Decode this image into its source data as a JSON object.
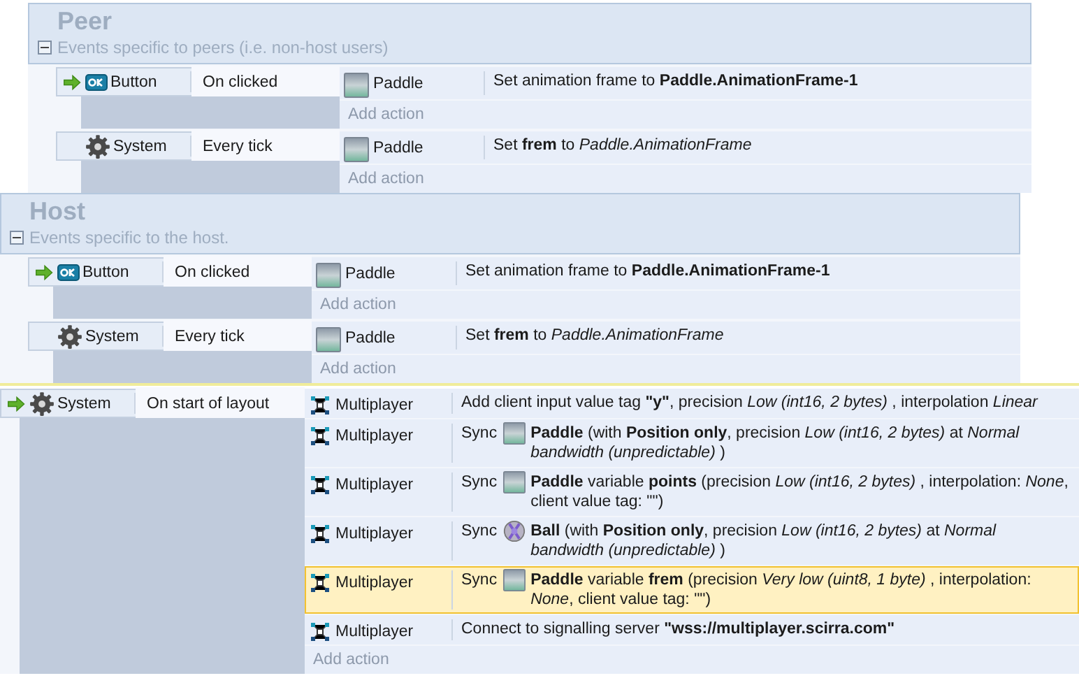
{
  "groups": [
    {
      "title": "Peer",
      "description": "Events specific to peers (i.e. non-host users)",
      "expanded": true,
      "events": [
        {
          "trigger": true,
          "conditions": [
            {
              "kind": "button",
              "object": "Button",
              "text": "On clicked"
            }
          ],
          "actions": [
            {
              "kind": "sprite",
              "object": "Paddle",
              "text": "Set animation frame to **Paddle.AnimationFrame-1**",
              "selected": false
            }
          ],
          "add_action": "Add action"
        },
        {
          "trigger": false,
          "conditions": [
            {
              "kind": "system",
              "object": "System",
              "text": "Every tick"
            }
          ],
          "actions": [
            {
              "kind": "sprite",
              "object": "Paddle",
              "text": "Set **frem** to *Paddle.AnimationFrame*",
              "selected": false
            }
          ],
          "add_action": "Add action"
        }
      ]
    },
    {
      "title": "Host",
      "description": "Events specific to the host.",
      "expanded": true,
      "events": [
        {
          "trigger": true,
          "conditions": [
            {
              "kind": "button",
              "object": "Button",
              "text": "On clicked"
            }
          ],
          "actions": [
            {
              "kind": "sprite",
              "object": "Paddle",
              "text": "Set animation frame to **Paddle.AnimationFrame-1**",
              "selected": false
            }
          ],
          "add_action": "Add action"
        },
        {
          "trigger": false,
          "conditions": [
            {
              "kind": "system",
              "object": "System",
              "text": "Every tick"
            }
          ],
          "actions": [
            {
              "kind": "sprite",
              "object": "Paddle",
              "text": "Set **frem** to *Paddle.AnimationFrame*",
              "selected": false
            }
          ],
          "add_action": "Add action"
        }
      ]
    }
  ],
  "events": [
    {
      "trigger": true,
      "conditions": [
        {
          "kind": "system",
          "object": "System",
          "text": "On start of layout"
        }
      ],
      "actions": [
        {
          "kind": "multiplayer",
          "object": "Multiplayer",
          "text": "Add client input value tag **\"y\"**, precision *Low (int16, 2 bytes)* , interpolation *Linear*",
          "selected": false
        },
        {
          "kind": "multiplayer",
          "object": "Multiplayer",
          "lead": "Sync",
          "target": {
            "kind": "sprite"
          },
          "text": "**Paddle** (with **Position only**, precision *Low (int16, 2 bytes)*  at *Normal bandwidth (unpredictable)* )",
          "selected": false
        },
        {
          "kind": "multiplayer",
          "object": "Multiplayer",
          "lead": "Sync",
          "target": {
            "kind": "sprite"
          },
          "text": "**Paddle** variable **points** (precision *Low (int16, 2 bytes)* , interpolation: *None*, client value tag: \"\")",
          "selected": false
        },
        {
          "kind": "multiplayer",
          "object": "Multiplayer",
          "lead": "Sync",
          "target": {
            "kind": "ball"
          },
          "text": "**Ball** (with **Position only**, precision *Low (int16, 2 bytes)*  at *Normal bandwidth (unpredictable)* )",
          "selected": false
        },
        {
          "kind": "multiplayer",
          "object": "Multiplayer",
          "lead": "Sync",
          "target": {
            "kind": "sprite"
          },
          "text": "**Paddle** variable **frem** (precision *Very low (uint8, 1 byte)* , interpolation: *None*, client value tag: \"\")",
          "selected": true
        },
        {
          "kind": "multiplayer",
          "object": "Multiplayer",
          "text": "Connect to signalling server **\"wss://multiplayer.scirra.com\"**",
          "selected": false
        }
      ],
      "add_action": "Add action"
    }
  ]
}
